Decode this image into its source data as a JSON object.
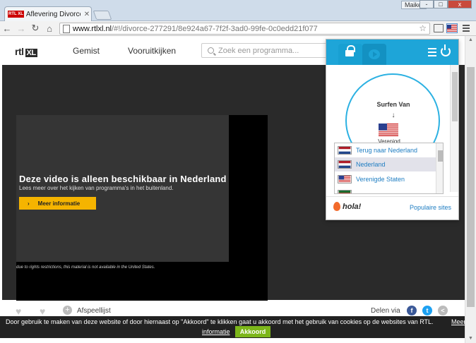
{
  "browser": {
    "tab_title": "Aflevering Divorce - zondag",
    "tab_favicon": "RTL XL",
    "user_name": "Maikel",
    "url_host": "www.rtlxl.nl",
    "url_path": "/#!/divorce-277291/8e924a67-7f2f-3ad0-99fe-0c0edd21f077"
  },
  "site": {
    "logo_text": "rtl",
    "logo_xl": "XL",
    "nav": [
      "Gemist",
      "Vooruitkijken"
    ],
    "search_placeholder": "Zoek een programma..."
  },
  "player": {
    "geo_title": "Deze video is alleen beschikbaar in Nederland",
    "geo_subtitle": "Lees meer over het kijken van programma's in het buitenland.",
    "more_button": "Meer informatie",
    "rights_notice": "due to rights restrictions, this material is not available in the United States."
  },
  "actions": {
    "playlist_label": "Afspeellijst",
    "share_label": "Delen via"
  },
  "cookie": {
    "text": "Door gebruik te maken van deze website of door hiernaast op \"Akkoord\" te klikken gaat u akkoord met het gebruik van cookies op de websites van RTL.",
    "more_link": "Meer",
    "info_link": "informatie",
    "accept_button": "Akkoord"
  },
  "hola": {
    "surf_label": "Surfen Van",
    "surf_arrow": "↓",
    "current_country_partial": "Verenigd",
    "countries": [
      {
        "label": "Terug naar Nederland",
        "flag": "nl"
      },
      {
        "label": "Nederland",
        "flag": "nl"
      },
      {
        "label": "Verenigde Staten",
        "flag": "us"
      },
      {
        "label": "...",
        "flag": "other"
      }
    ],
    "selected_index": 1,
    "logo_text": "hola!",
    "popular_sites": "Populaire sites",
    "accent_color": "#1ea5d8"
  },
  "window_controls": [
    "-",
    "□",
    "x"
  ]
}
